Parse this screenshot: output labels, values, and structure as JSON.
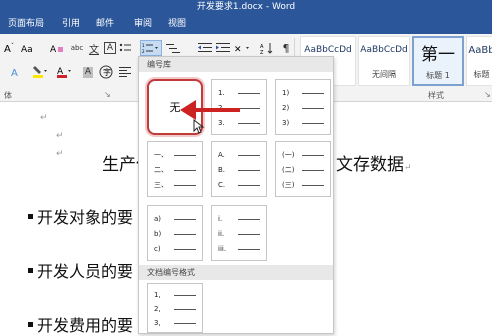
{
  "window": {
    "title": "开发要求1.docx - Word"
  },
  "menu_tabs": [
    "页面布局",
    "引用",
    "邮件",
    "审阅",
    "视图"
  ],
  "ribbon": {
    "font_group_label": "体",
    "styles": [
      {
        "sample": "AaBbCcDd",
        "name": ""
      },
      {
        "sample": "AaBbCcDd",
        "name": "无间隔"
      },
      {
        "sample": "第一",
        "name": "标题 1"
      },
      {
        "sample": "AaBb",
        "name": "标题"
      }
    ],
    "styles_group_label": "样式",
    "button_glyphs": {
      "abc_button": "abc",
      "wen_button": "文",
      "a_box_button": "A",
      "char_shading_button": "A",
      "font_color_button": "A"
    }
  },
  "numbering_dropdown": {
    "header_library": "编号库",
    "header_doc_formats": "文档编号格式",
    "none_label": "无",
    "formats": [
      {
        "id": "num-dot",
        "labels": [
          "1.",
          "2.",
          "3."
        ]
      },
      {
        "id": "num-paren",
        "labels": [
          "1)",
          "2)",
          "3)"
        ]
      },
      {
        "id": "cn-dun",
        "labels": [
          "一、",
          "二、",
          "三、"
        ]
      },
      {
        "id": "upper-alpha",
        "labels": [
          "A.",
          "B.",
          "C."
        ]
      },
      {
        "id": "cn-paren",
        "labels": [
          "(一)",
          "(二)",
          "(三)"
        ]
      },
      {
        "id": "lower-alpha",
        "labels": [
          "a)",
          "b)",
          "c)"
        ]
      },
      {
        "id": "lower-roman",
        "labels": [
          "i.",
          "ii.",
          "iii."
        ]
      },
      {
        "id": "doc-num-comma",
        "labels": [
          "1,",
          "2,",
          "3,"
        ]
      }
    ]
  },
  "document": {
    "heading_visible": "生产任",
    "heading_tail": "文存数据",
    "bullets": [
      "开发对象的要",
      "开发人员的要",
      "开发费用的要"
    ]
  },
  "colors": {
    "ribbon_blue": "#2b579a",
    "annotation_red": "#cc2222",
    "font_color_red": "#d0202a",
    "highlight_yellow": "#ffe600"
  }
}
